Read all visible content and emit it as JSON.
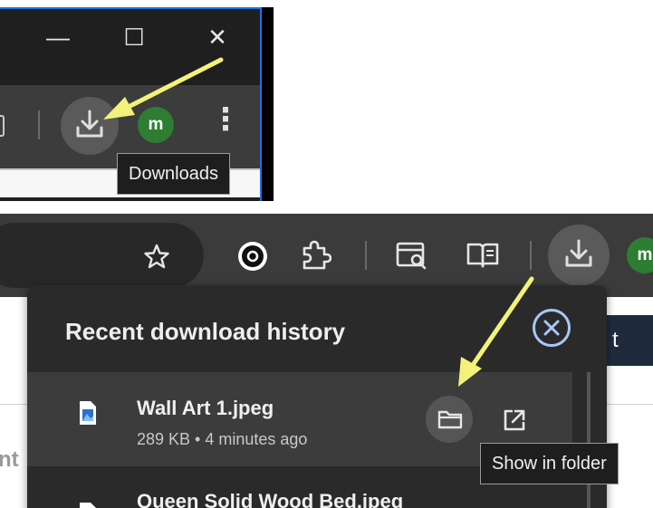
{
  "top": {
    "window_controls": [
      "—",
      "☐",
      "✕"
    ],
    "avatar_letter": "m",
    "menu_glyph": "⋮",
    "tooltip": "Downloads"
  },
  "bottom": {
    "avatar_letter": "m",
    "panel": {
      "title": "Recent download history",
      "items": [
        {
          "name": "Wall Art  1.jpeg",
          "meta": "289 KB • 4 minutes ago"
        },
        {
          "name": "Queen Solid Wood Bed.jpeg",
          "meta": ""
        }
      ],
      "tooltip": "Show in folder"
    },
    "page_text": {
      "right_button": "t",
      "left_text": "nt"
    }
  },
  "colors": {
    "annotation_arrow": "#f2f27a",
    "avatar": "#2e7d32",
    "accent": "#a8c7fa"
  },
  "icons": [
    "minimize-icon",
    "maximize-icon",
    "close-icon",
    "download-icon",
    "menu-icon",
    "star-icon",
    "extension-icon",
    "puzzle-icon",
    "reading-mode-icon",
    "reading-list-icon",
    "image-file-icon",
    "folder-icon",
    "open-external-icon",
    "close-circle-icon"
  ]
}
